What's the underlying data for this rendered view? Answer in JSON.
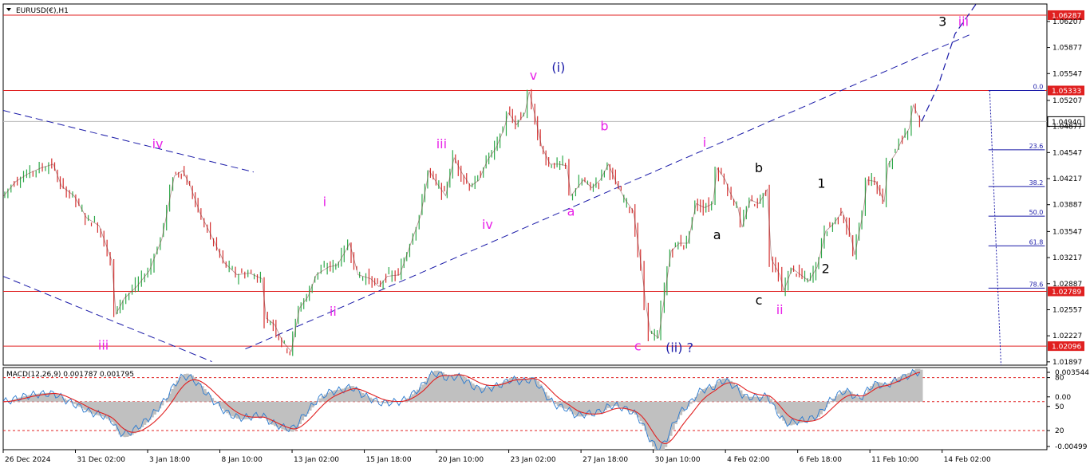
{
  "chart_data": {
    "type": "line",
    "symbol_title": "EURUSD(€),H1",
    "price_axis": {
      "min": 1.01855,
      "max": 1.06428,
      "ticks": [
        "1.06207",
        "1.05877",
        "1.05547",
        "1.05207",
        "1.04877",
        "1.04547",
        "1.04217",
        "1.03887",
        "1.03547",
        "1.03217",
        "1.02887",
        "1.02557",
        "1.02227",
        "1.01897"
      ]
    },
    "time_axis": {
      "ticks": [
        "26 Dec 2024",
        "31 Dec 02:00",
        "3 Jan 18:00",
        "8 Jan 10:00",
        "13 Jan 02:00",
        "15 Jan 18:00",
        "20 Jan 10:00",
        "23 Jan 02:00",
        "27 Jan 18:00",
        "30 Jan 10:00",
        "4 Feb 02:00",
        "6 Feb 18:00",
        "11 Feb 10:00",
        "14 Feb 02:00"
      ]
    },
    "price_path": [
      {
        "t": 0,
        "p": 1.0399
      },
      {
        "t": 3,
        "p": 1.0418
      },
      {
        "t": 6,
        "p": 1.0428
      },
      {
        "t": 9,
        "p": 1.0435
      },
      {
        "t": 12,
        "p": 1.044
      },
      {
        "t": 14,
        "p": 1.0412
      },
      {
        "t": 17,
        "p": 1.04
      },
      {
        "t": 20,
        "p": 1.0372
      },
      {
        "t": 23,
        "p": 1.0362
      },
      {
        "t": 26,
        "p": 1.0318
      },
      {
        "t": 27,
        "p": 1.025
      },
      {
        "t": 29,
        "p": 1.027
      },
      {
        "t": 32,
        "p": 1.0285
      },
      {
        "t": 35,
        "p": 1.0305
      },
      {
        "t": 38,
        "p": 1.0345
      },
      {
        "t": 41,
        "p": 1.0425
      },
      {
        "t": 43,
        "p": 1.0432
      },
      {
        "t": 45,
        "p": 1.041
      },
      {
        "t": 47,
        "p": 1.038
      },
      {
        "t": 50,
        "p": 1.0348
      },
      {
        "t": 53,
        "p": 1.0315
      },
      {
        "t": 56,
        "p": 1.03
      },
      {
        "t": 59,
        "p": 1.0302
      },
      {
        "t": 62,
        "p": 1.0295
      },
      {
        "t": 63,
        "p": 1.0245
      },
      {
        "t": 65,
        "p": 1.0237
      },
      {
        "t": 67,
        "p": 1.0215
      },
      {
        "t": 69,
        "p": 1.0203
      },
      {
        "t": 71,
        "p": 1.0258
      },
      {
        "t": 73,
        "p": 1.0272
      },
      {
        "t": 75,
        "p": 1.03
      },
      {
        "t": 78,
        "p": 1.031
      },
      {
        "t": 80,
        "p": 1.0312
      },
      {
        "t": 82,
        "p": 1.033
      },
      {
        "t": 83,
        "p": 1.034
      },
      {
        "t": 85,
        "p": 1.03
      },
      {
        "t": 88,
        "p": 1.0295
      },
      {
        "t": 90,
        "p": 1.0285
      },
      {
        "t": 92,
        "p": 1.0298
      },
      {
        "t": 95,
        "p": 1.03
      },
      {
        "t": 97,
        "p": 1.033
      },
      {
        "t": 100,
        "p": 1.0375
      },
      {
        "t": 102,
        "p": 1.0432
      },
      {
        "t": 104,
        "p": 1.0415
      },
      {
        "t": 106,
        "p": 1.04
      },
      {
        "t": 108,
        "p": 1.0448
      },
      {
        "t": 110,
        "p": 1.0428
      },
      {
        "t": 112,
        "p": 1.0412
      },
      {
        "t": 114,
        "p": 1.042
      },
      {
        "t": 116,
        "p": 1.0445
      },
      {
        "t": 118,
        "p": 1.046
      },
      {
        "t": 120,
        "p": 1.0485
      },
      {
        "t": 121,
        "p": 1.0505
      },
      {
        "t": 123,
        "p": 1.049
      },
      {
        "t": 125,
        "p": 1.0505
      },
      {
        "t": 126,
        "p": 1.0532
      },
      {
        "t": 127,
        "p": 1.051
      },
      {
        "t": 129,
        "p": 1.0462
      },
      {
        "t": 131,
        "p": 1.044
      },
      {
        "t": 133,
        "p": 1.044
      },
      {
        "t": 135,
        "p": 1.0438
      },
      {
        "t": 136,
        "p": 1.04
      },
      {
        "t": 139,
        "p": 1.042
      },
      {
        "t": 141,
        "p": 1.041
      },
      {
        "t": 143,
        "p": 1.042
      },
      {
        "t": 145,
        "p": 1.044
      },
      {
        "t": 147,
        "p": 1.0415
      },
      {
        "t": 149,
        "p": 1.0395
      },
      {
        "t": 151,
        "p": 1.038
      },
      {
        "t": 153,
        "p": 1.0305
      },
      {
        "t": 154,
        "p": 1.026
      },
      {
        "t": 155,
        "p": 1.0228
      },
      {
        "t": 157,
        "p": 1.022
      },
      {
        "t": 158,
        "p": 1.0258
      },
      {
        "t": 160,
        "p": 1.033
      },
      {
        "t": 162,
        "p": 1.034
      },
      {
        "t": 164,
        "p": 1.034
      },
      {
        "t": 166,
        "p": 1.039
      },
      {
        "t": 168,
        "p": 1.0385
      },
      {
        "t": 170,
        "p": 1.039
      },
      {
        "t": 171,
        "p": 1.0435
      },
      {
        "t": 173,
        "p": 1.042
      },
      {
        "t": 174,
        "p": 1.0405
      },
      {
        "t": 176,
        "p": 1.0385
      },
      {
        "t": 177,
        "p": 1.036
      },
      {
        "t": 179,
        "p": 1.0395
      },
      {
        "t": 181,
        "p": 1.039
      },
      {
        "t": 183,
        "p": 1.0408
      },
      {
        "t": 184,
        "p": 1.032
      },
      {
        "t": 186,
        "p": 1.03
      },
      {
        "t": 187,
        "p": 1.028
      },
      {
        "t": 189,
        "p": 1.0308
      },
      {
        "t": 191,
        "p": 1.03
      },
      {
        "t": 193,
        "p": 1.0292
      },
      {
        "t": 195,
        "p": 1.031
      },
      {
        "t": 197,
        "p": 1.0355
      },
      {
        "t": 199,
        "p": 1.0365
      },
      {
        "t": 201,
        "p": 1.038
      },
      {
        "t": 203,
        "p": 1.035
      },
      {
        "t": 204,
        "p": 1.0325
      },
      {
        "t": 206,
        "p": 1.038
      },
      {
        "t": 207,
        "p": 1.042
      },
      {
        "t": 209,
        "p": 1.0418
      },
      {
        "t": 211,
        "p": 1.0392
      },
      {
        "t": 212,
        "p": 1.044
      },
      {
        "t": 214,
        "p": 1.0455
      },
      {
        "t": 215,
        "p": 1.0468
      },
      {
        "t": 217,
        "p": 1.0485
      },
      {
        "t": 218,
        "p": 1.0515
      },
      {
        "t": 219,
        "p": 1.0503
      },
      {
        "t": 220,
        "p": 1.0494
      }
    ],
    "resistance_lines": [
      {
        "price": 1.06287,
        "label": "1.06287"
      },
      {
        "price": 1.05333,
        "label": "1.05333"
      },
      {
        "price": 1.02789,
        "label": "1.02789"
      },
      {
        "price": 1.02096,
        "label": "1.02096"
      }
    ],
    "current_price": {
      "price": 1.0494,
      "label": "1.04940"
    },
    "fibonacci_levels": [
      {
        "level": "0.0",
        "price": 1.05333
      },
      {
        "level": "23.6",
        "price": 1.04582
      },
      {
        "level": "38.2",
        "price": 1.04117
      },
      {
        "level": "50.0",
        "price": 1.03741
      },
      {
        "level": "61.8",
        "price": 1.03366
      },
      {
        "level": "78.6",
        "price": 1.02831
      }
    ],
    "channels": [
      {
        "from": {
          "t": 58,
          "p": 1.0206
        },
        "to": {
          "t": 232,
          "p": 1.0605
        }
      },
      {
        "from": {
          "t": 0,
          "p": 1.0508
        },
        "to": {
          "t": 60,
          "p": 1.043
        }
      },
      {
        "from": {
          "t": 0,
          "p": 1.0298
        },
        "to": {
          "t": 50,
          "p": 1.019
        }
      }
    ],
    "projection_path": [
      {
        "t": 220,
        "p": 1.0494
      },
      {
        "t": 224,
        "p": 1.054
      },
      {
        "t": 228,
        "p": 1.0605
      },
      {
        "t": 234,
        "p": 1.065
      }
    ],
    "wave_labels": [
      {
        "text": "iv",
        "t": 37,
        "p": 1.046,
        "color": "#e820e8"
      },
      {
        "text": "iii",
        "t": 24,
        "p": 1.0205,
        "color": "#e820e8"
      },
      {
        "text": "i",
        "t": 77,
        "p": 1.0387,
        "color": "#e820e8"
      },
      {
        "text": "ii",
        "t": 79,
        "p": 1.0248,
        "color": "#e820e8"
      },
      {
        "text": "iii",
        "t": 105,
        "p": 1.046,
        "color": "#e820e8"
      },
      {
        "text": "iv",
        "t": 116,
        "p": 1.0358,
        "color": "#e820e8"
      },
      {
        "text": "v",
        "t": 127,
        "p": 1.0547,
        "color": "#e820e8"
      },
      {
        "text": "(i)",
        "t": 133,
        "p": 1.0557,
        "color": "#1a1aa8"
      },
      {
        "text": "b",
        "t": 144,
        "p": 1.0483,
        "color": "#e820e8"
      },
      {
        "text": "a",
        "t": 136,
        "p": 1.0375,
        "color": "#e820e8"
      },
      {
        "text": "c",
        "t": 152,
        "p": 1.0204,
        "color": "#e820e8"
      },
      {
        "text": "(ii) ?",
        "t": 162,
        "p": 1.0202,
        "color": "#1a1aa8"
      },
      {
        "text": "i",
        "t": 168,
        "p": 1.0462,
        "color": "#e820e8"
      },
      {
        "text": "b",
        "t": 181,
        "p": 1.043,
        "color": "#000000"
      },
      {
        "text": "a",
        "t": 171,
        "p": 1.0345,
        "color": "#000000"
      },
      {
        "text": "c",
        "t": 181,
        "p": 1.0262,
        "color": "#000000"
      },
      {
        "text": "ii",
        "t": 186,
        "p": 1.025,
        "color": "#e820e8"
      },
      {
        "text": "1",
        "t": 196,
        "p": 1.041,
        "color": "#000000"
      },
      {
        "text": "2",
        "t": 197,
        "p": 1.0302,
        "color": "#000000"
      },
      {
        "text": "3",
        "t": 225,
        "p": 1.0615,
        "color": "#000000"
      },
      {
        "text": "iii",
        "t": 230,
        "p": 1.0615,
        "color": "#e820e8"
      }
    ],
    "macd": {
      "title": "MACD(12,26,9) 0.001787 0.001795",
      "fast": 12,
      "slow": 26,
      "signal": 9,
      "value": 0.001787,
      "signal_value": 0.001795,
      "axis_ticks": [
        "0.003544",
        "80",
        "0.00",
        "50",
        "20",
        "-0.00499"
      ]
    }
  }
}
